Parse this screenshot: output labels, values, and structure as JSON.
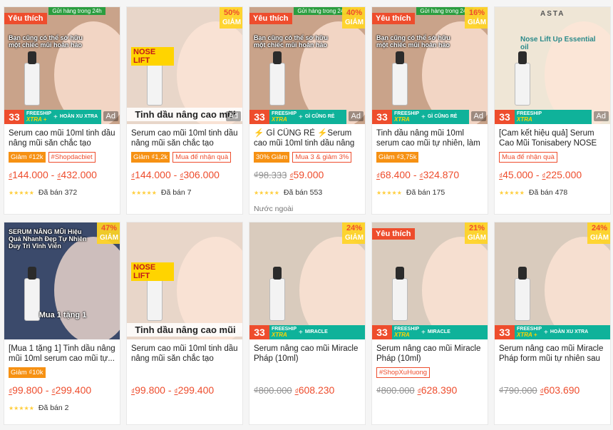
{
  "products": [
    {
      "title": "Serum cao mũi 10ml tinh dầu nâng mũi săn chắc tạo dáng...",
      "fav_label": "Yêu thích",
      "ship24": "Gửi hàng trong 24h",
      "overlay": "Bạn cũng có thể sở hữu một chiếc mũi hoàn hảo",
      "discount": "",
      "ad": "Ad",
      "promo": {
        "n": "33",
        "fs": "FREESHIP",
        "fsx": "XTRA +",
        "extra": "HOÀN XU XTRA"
      },
      "tags": [
        {
          "text": "Giảm ₫12k",
          "style": "fill"
        },
        {
          "text": "#Shopdacbiet",
          "style": "outline"
        }
      ],
      "price_cur1": "₫",
      "price_low": "144.000",
      "sep": " - ",
      "price_cur2": "₫",
      "price_high": "432.000",
      "stars": "★★★★★",
      "sold": "Đã bán 372",
      "bg": "#c9a38a"
    },
    {
      "title": "Serum cao mũi 10ml tinh dầu nâng mũi săn chắc tạo dáng...",
      "fav_label": "",
      "ship24": "",
      "overlay": "NOSE LIFT",
      "caption": "Tinh dầu nâng cao mũi",
      "discount": "50%",
      "discount_lbl": "GIẢM",
      "ad": "Ad",
      "tags": [
        {
          "text": "Giảm ₫1,2k",
          "style": "fill"
        },
        {
          "text": "Mua để nhận quà",
          "style": "outline"
        }
      ],
      "price_cur1": "₫",
      "price_low": "144.000",
      "sep": " - ",
      "price_cur2": "₫",
      "price_high": "306.000",
      "stars": "★★★★★",
      "sold": "Đã bán 7",
      "bg": "#e8d6c9"
    },
    {
      "title": "⚡ GÌ CŨNG RẺ ⚡Serum cao mũi 10ml tinh dầu nâng mũi...",
      "fav_label": "Yêu thích",
      "ship24": "Gửi hàng trong 24h",
      "overlay": "Bạn cũng có thể sở hữu một chiếc mũi hoàn hảo",
      "discount": "40%",
      "discount_lbl": "GIẢM",
      "ad": "Ad",
      "promo": {
        "n": "33",
        "fs": "FREESHIP",
        "fsx": "XTRA",
        "extra": "GÌ CŨNG RẺ"
      },
      "tags": [
        {
          "text": "30% Giảm",
          "style": "fill"
        },
        {
          "text": "Mua 3 & giảm 3%",
          "style": "outline"
        }
      ],
      "price_old": "₫98.333",
      "price_cur1": "₫",
      "price_low": "59.000",
      "stars": "★★★★★",
      "sold": "Đã bán 553",
      "origin": "Nước ngoài",
      "bg": "#c9a38a"
    },
    {
      "title": "Tinh dầu nâng mũi 10ml serum cao mũi tự nhiên, làm đẹp m...",
      "fav_label": "Yêu thích",
      "ship24": "Gửi hàng trong 24h",
      "overlay": "Bạn cũng có thể sở hữu một chiếc mũi hoàn hảo",
      "discount": "16%",
      "discount_lbl": "GIẢM",
      "ad": "Ad",
      "promo": {
        "n": "33",
        "fs": "FREESHIP",
        "fsx": "XTRA",
        "extra": "GÌ CŨNG RẺ"
      },
      "tags": [
        {
          "text": "Giảm ₫3,75k",
          "style": "fill"
        }
      ],
      "price_cur1": "₫",
      "price_low": "68.400",
      "sep": " - ",
      "price_cur2": "₫",
      "price_high": "324.870",
      "stars": "★★★★★",
      "sold": "Đã bán 175",
      "bg": "#c9a38a"
    },
    {
      "title": "[Cam kết hiệu quả] Serum Cao Mũi Tonisabery NOSE và Dụ...",
      "fav_label": "",
      "ship24": "",
      "overlay": "Nose Lift Up Essential oil",
      "brand": "ASTA",
      "discount": "",
      "ad": "Ad",
      "promo": {
        "n": "33",
        "fs": "FREESHIP",
        "fsx": "XTRA",
        "extra": ""
      },
      "tags": [
        {
          "text": "Mua để nhận quà",
          "style": "outline"
        }
      ],
      "price_cur1": "₫",
      "price_low": "45.000",
      "sep": " - ",
      "price_cur2": "₫",
      "price_high": "225.000",
      "stars": "★★★★★",
      "sold": "Đã bán 478",
      "bg": "#efe6d6"
    },
    {
      "title": "[Mua 1 tặng 1] Tinh dầu nâng mũi 10ml serum cao mũi tự...",
      "fav_label": "",
      "ship24": "",
      "overlay": "SERUM NÂNG MŨI Hiệu Quả Nhanh Đẹp Tự Nhiên Duy Trì Vĩnh Viễn",
      "caption": "Mua 1 tặng 1",
      "discount": "47%",
      "discount_lbl": "GIẢM",
      "ad": "",
      "tags": [
        {
          "text": "Giảm ₫10k",
          "style": "fill"
        }
      ],
      "price_cur1": "₫",
      "price_low": "99.800",
      "sep": " - ",
      "price_cur2": "₫",
      "price_high": "299.400",
      "stars": "★★★★★",
      "sold": "Đã bán 2",
      "bg": "#3b4a6b"
    },
    {
      "title": "Serum cao mũi 10ml tinh dầu nâng mũi săn chắc tạo dáng...",
      "fav_label": "",
      "ship24": "",
      "overlay": "NOSE LIFT",
      "caption": "Tinh dầu nâng cao mũi",
      "discount": "",
      "ad": "",
      "tags": [],
      "price_cur1": "₫",
      "price_low": "99.800",
      "sep": " - ",
      "price_cur2": "₫",
      "price_high": "299.400",
      "stars": "",
      "sold": "",
      "bg": "#e8d6c9"
    },
    {
      "title": "Serum nâng cao mũi Miracle Pháp (10ml)",
      "fav_label": "",
      "ship24": "",
      "overlay": "",
      "discount": "24%",
      "discount_lbl": "GIẢM",
      "ad": "",
      "promo": {
        "n": "33",
        "fs": "FREESHIP",
        "fsx": "XTRA",
        "extra": "MIRACLE"
      },
      "tags": [],
      "price_old": "₫800.000",
      "price_cur1": "₫",
      "price_low": "608.230",
      "stars": "",
      "sold": "",
      "bg": "#d9cbbd"
    },
    {
      "title": "Serum nâng cao mũi Miracle Pháp (10ml)",
      "fav_label": "Yêu thích",
      "ship24": "",
      "overlay": "",
      "discount": "21%",
      "discount_lbl": "GIẢM",
      "ad": "",
      "promo": {
        "n": "33",
        "fs": "FREESHIP",
        "fsx": "XTRA",
        "extra": "MIRACLE"
      },
      "tags": [
        {
          "text": "#ShopXuHuong",
          "style": "outline"
        }
      ],
      "price_old": "₫800.000",
      "price_cur1": "₫",
      "price_low": "628.390",
      "stars": "",
      "sold": "",
      "bg": "#d9cbbd"
    },
    {
      "title": "Serum nâng cao mũi Miracle Pháp form mũi tự nhiên sau ...",
      "fav_label": "",
      "ship24": "",
      "overlay": "",
      "discount": "24%",
      "discount_lbl": "GIẢM",
      "ad": "",
      "promo": {
        "n": "33",
        "fs": "FREESHIP",
        "fsx": "XTRA +",
        "extra": "HOÀN XU XTRA"
      },
      "tags": [],
      "price_old": "₫790.000",
      "price_cur1": "₫",
      "price_low": "603.690",
      "stars": "",
      "sold": "",
      "bg": "#d9cbbd"
    }
  ]
}
